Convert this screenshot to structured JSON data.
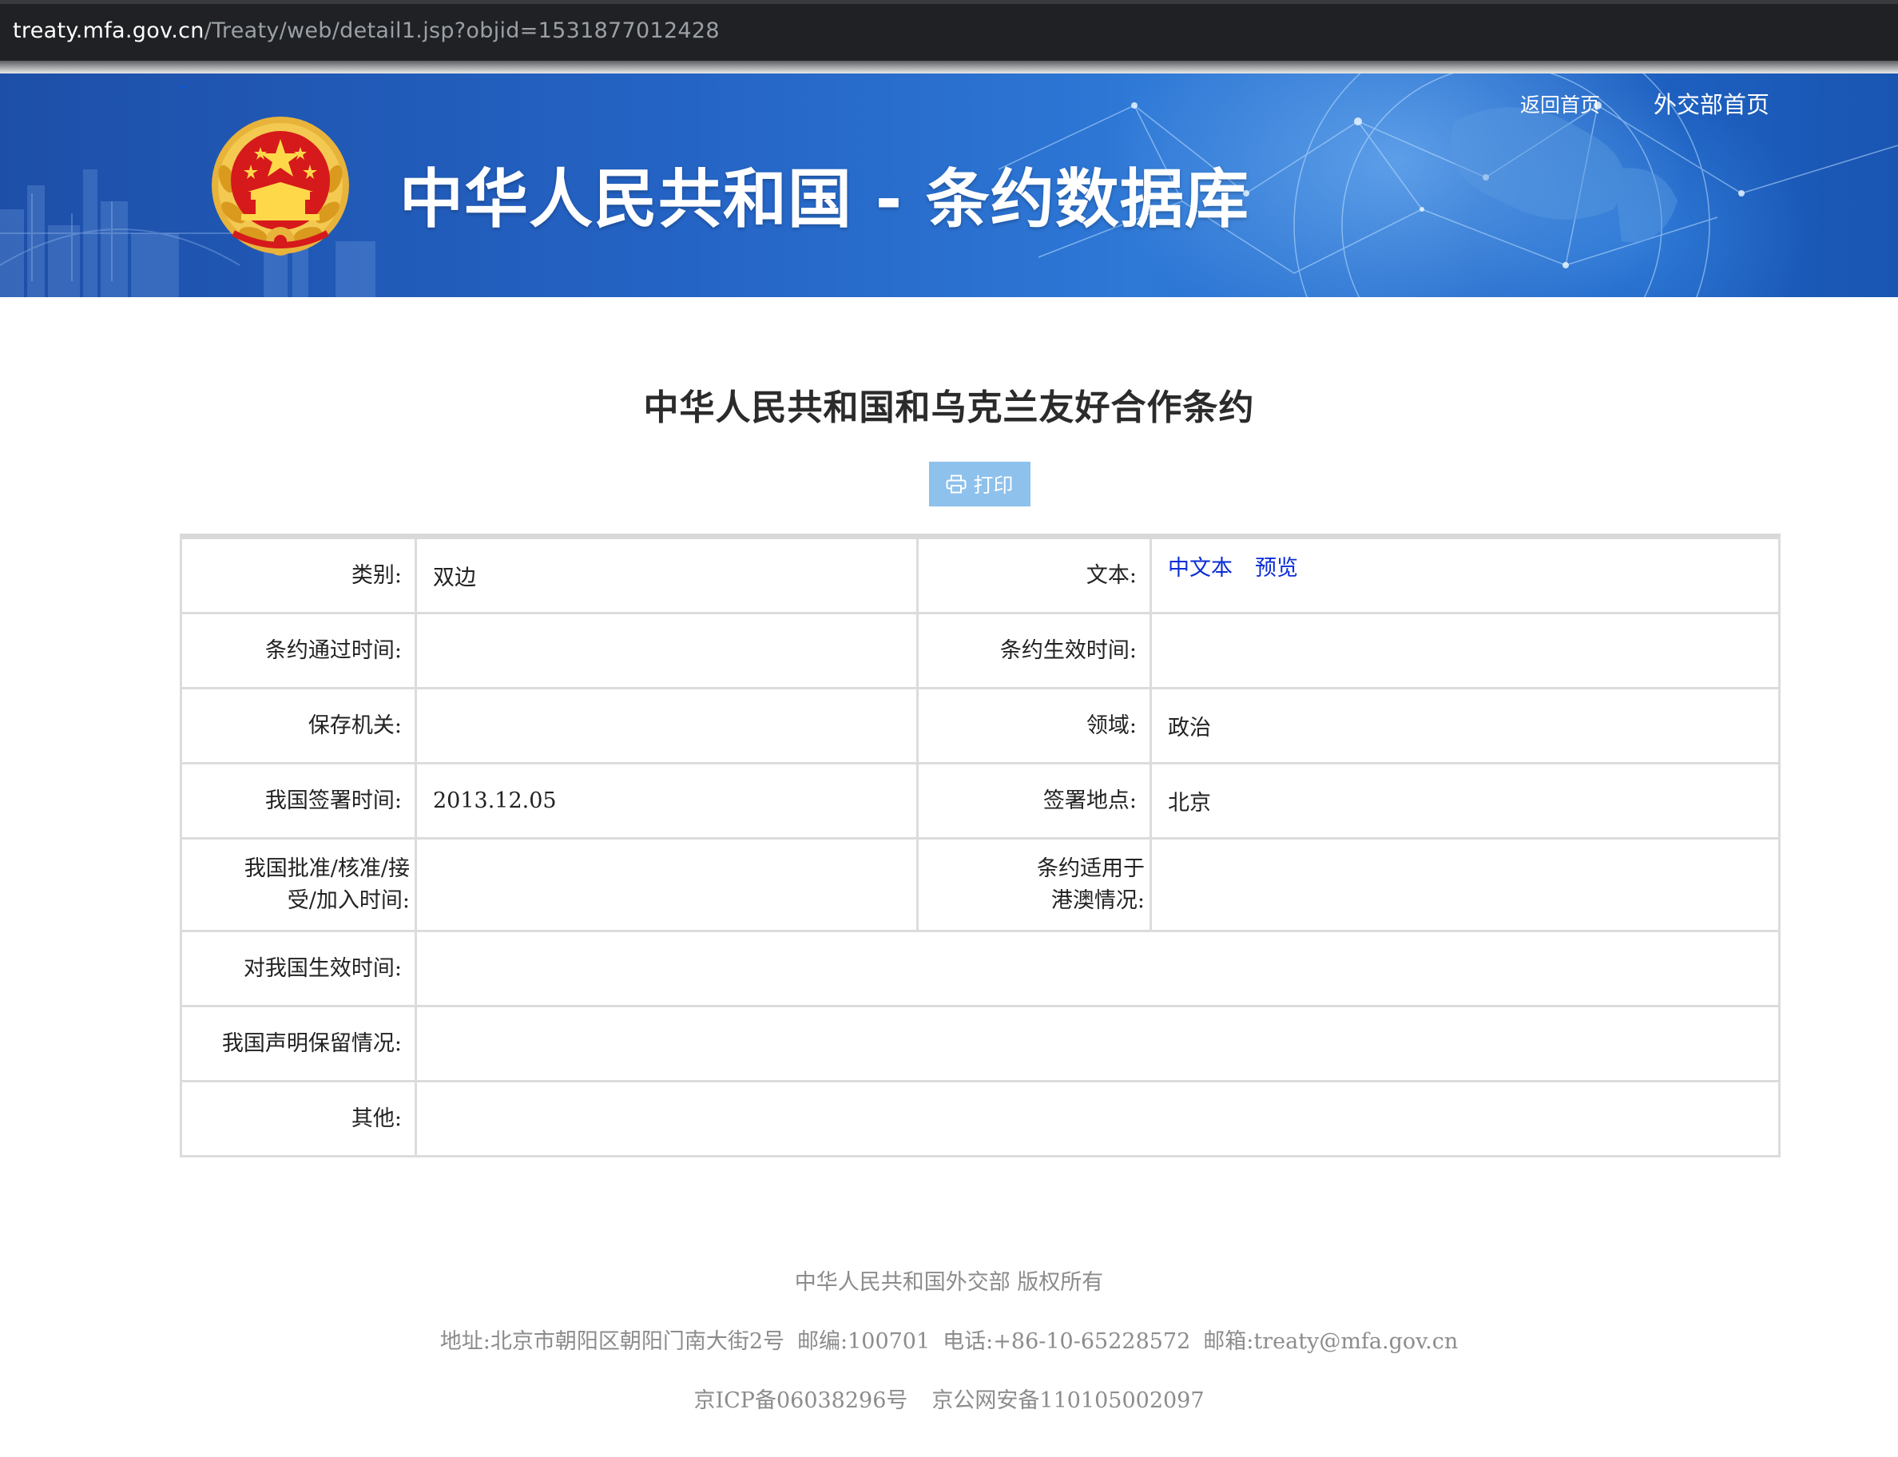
{
  "browser": {
    "url_host": "treaty.mfa.gov.cn",
    "url_path": "/Treaty/web/detail1.jsp?objid=1531877012428"
  },
  "header": {
    "site_title": "中华人民共和国 - 条约数据库",
    "links": {
      "home": "返回首页",
      "mfa_home": "外交部首页"
    },
    "emblem_icon": "national-emblem-icon"
  },
  "treaty": {
    "title": "中华人民共和国和乌克兰友好合作条约",
    "print_label": "打印",
    "print_icon": "printer-icon"
  },
  "details": {
    "category_label": "类别:",
    "category_value": "双边",
    "text_label": "文本:",
    "text_links": [
      "中文本",
      "预览"
    ],
    "adopted_label": "条约通过时间:",
    "adopted_value": "",
    "effective_label": "条约生效时间:",
    "effective_value": "",
    "depositary_label": "保存机关:",
    "depositary_value": "",
    "field_label": "领域:",
    "field_value": "政治",
    "signed_date_label": "我国签署时间:",
    "signed_date_value": "2013.12.05",
    "signed_place_label": "签署地点:",
    "signed_place_value": "北京",
    "ratified_label": "我国批准/核准/接受/加入时间:",
    "ratified_value": "",
    "hk_macao_label": "条约适用于港澳情况:",
    "hk_macao_value": "",
    "china_effective_label": "对我国生效时间:",
    "china_effective_value": "",
    "reservation_label": "我国声明保留情况:",
    "reservation_value": "",
    "other_label": "其他:",
    "other_value": ""
  },
  "footer": {
    "copyright": "中华人民共和国外交部 版权所有",
    "address": "地址:北京市朝阳区朝阳门南大街2号",
    "postcode": "邮编:100701",
    "phone": "电话:+86-10-65228572",
    "email": "邮箱:treaty@mfa.gov.cn",
    "icp": "京ICP备06038296号",
    "police": "京公网安备110105002097"
  },
  "colors": {
    "banner_blue": "#2463c4",
    "link_blue": "#0a2dd6",
    "print_button": "#8ec1ec",
    "table_border": "#dcdcdc",
    "footer_text": "#8c8c8c"
  }
}
